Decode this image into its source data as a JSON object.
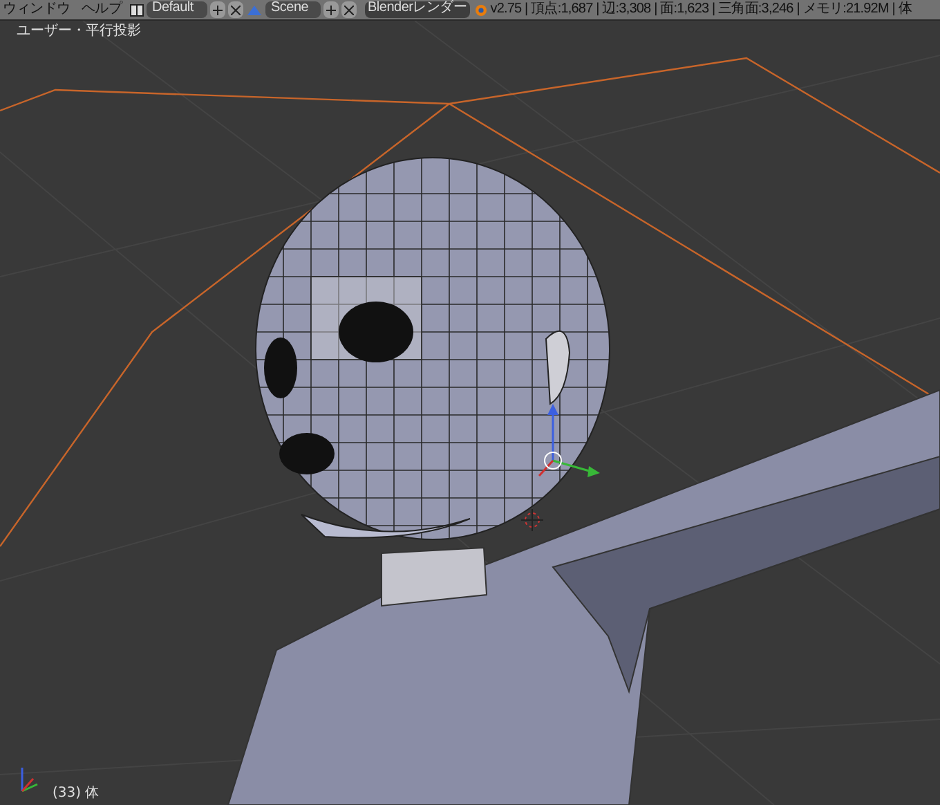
{
  "menu": [
    {
      "label": "ウィンドウ"
    },
    {
      "label": "ヘルプ"
    }
  ],
  "screen_layout": {
    "value": "Default"
  },
  "scene": {
    "value": "Scene"
  },
  "render_engine": {
    "value": "Blenderレンダー"
  },
  "stats": "v2.75 | 頂点:1,687 | 辺:3,308 | 面:1,623 | 三角面:3,246 | メモリ:21.92M | 体",
  "viewport": {
    "view_label": "ユーザー・平行投影",
    "frame_object": "(33) 体"
  }
}
